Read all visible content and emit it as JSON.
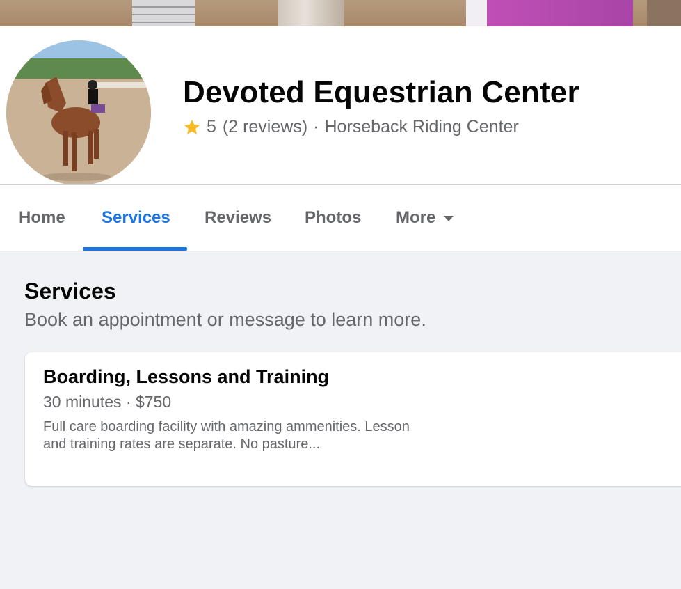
{
  "page": {
    "name": "Devoted Equestrian Center",
    "rating": "5",
    "reviews": "(2 reviews)",
    "separator": "·",
    "category": "Horseback Riding Center"
  },
  "tabs": [
    {
      "label": "Home"
    },
    {
      "label": "Services",
      "active": true
    },
    {
      "label": "Reviews"
    },
    {
      "label": "Photos"
    },
    {
      "label": "More"
    }
  ],
  "services_section": {
    "title": "Services",
    "subtitle": "Book an appointment or message to learn more."
  },
  "service_card": {
    "title": "Boarding, Lessons and Training",
    "meta": "30 minutes · $750",
    "description": "Full care boarding facility with amazing ammenities. Lesson and training rates are separate. No pasture..."
  },
  "colors": {
    "accent": "#1b74e4",
    "star": "#f7b928",
    "text_secondary": "#65676b"
  },
  "icons": {
    "rating": "star-icon",
    "more": "caret-down-icon"
  }
}
